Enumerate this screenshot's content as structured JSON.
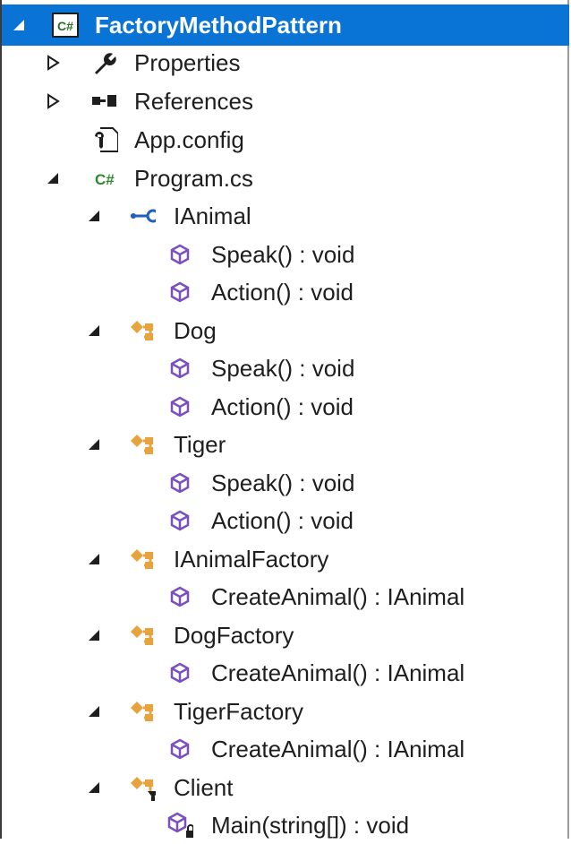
{
  "tree": {
    "project": {
      "label": "FactoryMethodPattern",
      "icon": "csharp-project-icon",
      "expander": "expanded-icon",
      "selected": true
    },
    "items": [
      {
        "name": "properties",
        "label": "Properties",
        "icon": "wrench-icon",
        "expander": "collapsed-icon"
      },
      {
        "name": "references",
        "label": "References",
        "icon": "references-icon",
        "expander": "collapsed-icon"
      },
      {
        "name": "app-config",
        "label": "App.config",
        "icon": "config-file-icon",
        "expander": ""
      },
      {
        "name": "program-cs",
        "label": "Program.cs",
        "icon": "csharp-file-icon",
        "expander": "expanded-icon"
      },
      {
        "name": "ianimal",
        "label": "IAnimal",
        "icon": "interface-icon",
        "expander": "expanded-icon"
      },
      {
        "name": "ianimal-speak",
        "label": "Speak() : void",
        "icon": "method-icon",
        "expander": ""
      },
      {
        "name": "ianimal-action",
        "label": "Action() : void",
        "icon": "method-icon",
        "expander": ""
      },
      {
        "name": "dog",
        "label": "Dog",
        "icon": "class-icon",
        "expander": "expanded-icon"
      },
      {
        "name": "dog-speak",
        "label": "Speak() : void",
        "icon": "method-icon",
        "expander": ""
      },
      {
        "name": "dog-action",
        "label": "Action() : void",
        "icon": "method-icon",
        "expander": ""
      },
      {
        "name": "tiger",
        "label": "Tiger",
        "icon": "class-icon",
        "expander": "expanded-icon"
      },
      {
        "name": "tiger-speak",
        "label": "Speak() : void",
        "icon": "method-icon",
        "expander": ""
      },
      {
        "name": "tiger-action",
        "label": "Action() : void",
        "icon": "method-icon",
        "expander": ""
      },
      {
        "name": "ianimalfactory",
        "label": "IAnimalFactory",
        "icon": "class-icon",
        "expander": "expanded-icon"
      },
      {
        "name": "ianimalfactory-create",
        "label": "CreateAnimal() : IAnimal",
        "icon": "method-icon",
        "expander": ""
      },
      {
        "name": "dogfactory",
        "label": "DogFactory",
        "icon": "class-icon",
        "expander": "expanded-icon"
      },
      {
        "name": "dogfactory-create",
        "label": "CreateAnimal() : IAnimal",
        "icon": "method-icon",
        "expander": ""
      },
      {
        "name": "tigerfactory",
        "label": "TigerFactory",
        "icon": "class-icon",
        "expander": "expanded-icon"
      },
      {
        "name": "tigerfactory-create",
        "label": "CreateAnimal() : IAnimal",
        "icon": "method-icon",
        "expander": ""
      },
      {
        "name": "client",
        "label": "Client",
        "icon": "internal-class-icon",
        "expander": "expanded-icon"
      },
      {
        "name": "client-main",
        "label": "Main(string[]) : void",
        "icon": "private-method-icon",
        "expander": ""
      }
    ]
  },
  "colors": {
    "selection": "#0a74d6",
    "class": "#e8a33d",
    "method": "#7b4fc0",
    "interface": "#1f5fbf",
    "csharp": "#3a8a3a"
  }
}
